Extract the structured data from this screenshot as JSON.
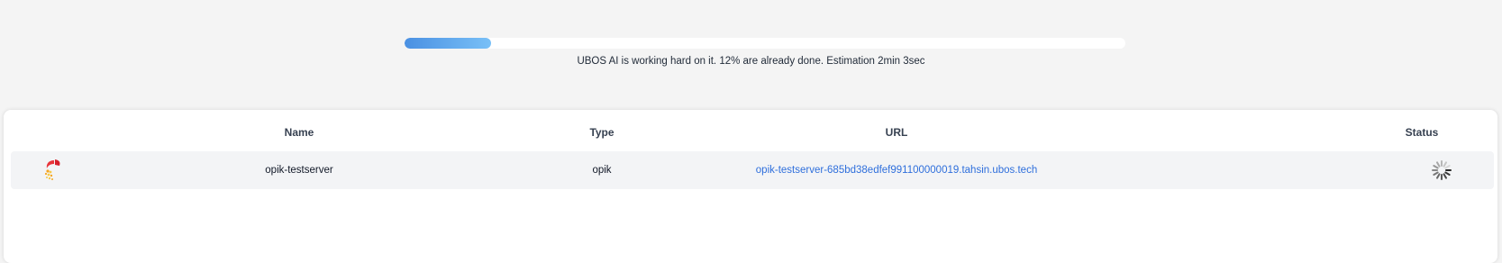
{
  "progress": {
    "fraction": 0.12,
    "message": "UBOS AI is working hard on it. 12% are already done. Estimation 2min 3sec"
  },
  "table": {
    "headers": {
      "name": "Name",
      "type": "Type",
      "url": "URL",
      "status": "Status"
    },
    "rows": [
      {
        "icon": "opik-logo-icon",
        "name": "opik-testserver",
        "type": "opik",
        "url": "opik-testserver-685bd38edfef991100000019.tahsin.ubos.tech",
        "status_icon": "loading-spinner-icon"
      }
    ]
  },
  "colors": {
    "progress_start": "#4a90e2",
    "progress_end": "#79c0f7",
    "link": "#2f6fdc",
    "row_bg": "#f3f4f6"
  }
}
